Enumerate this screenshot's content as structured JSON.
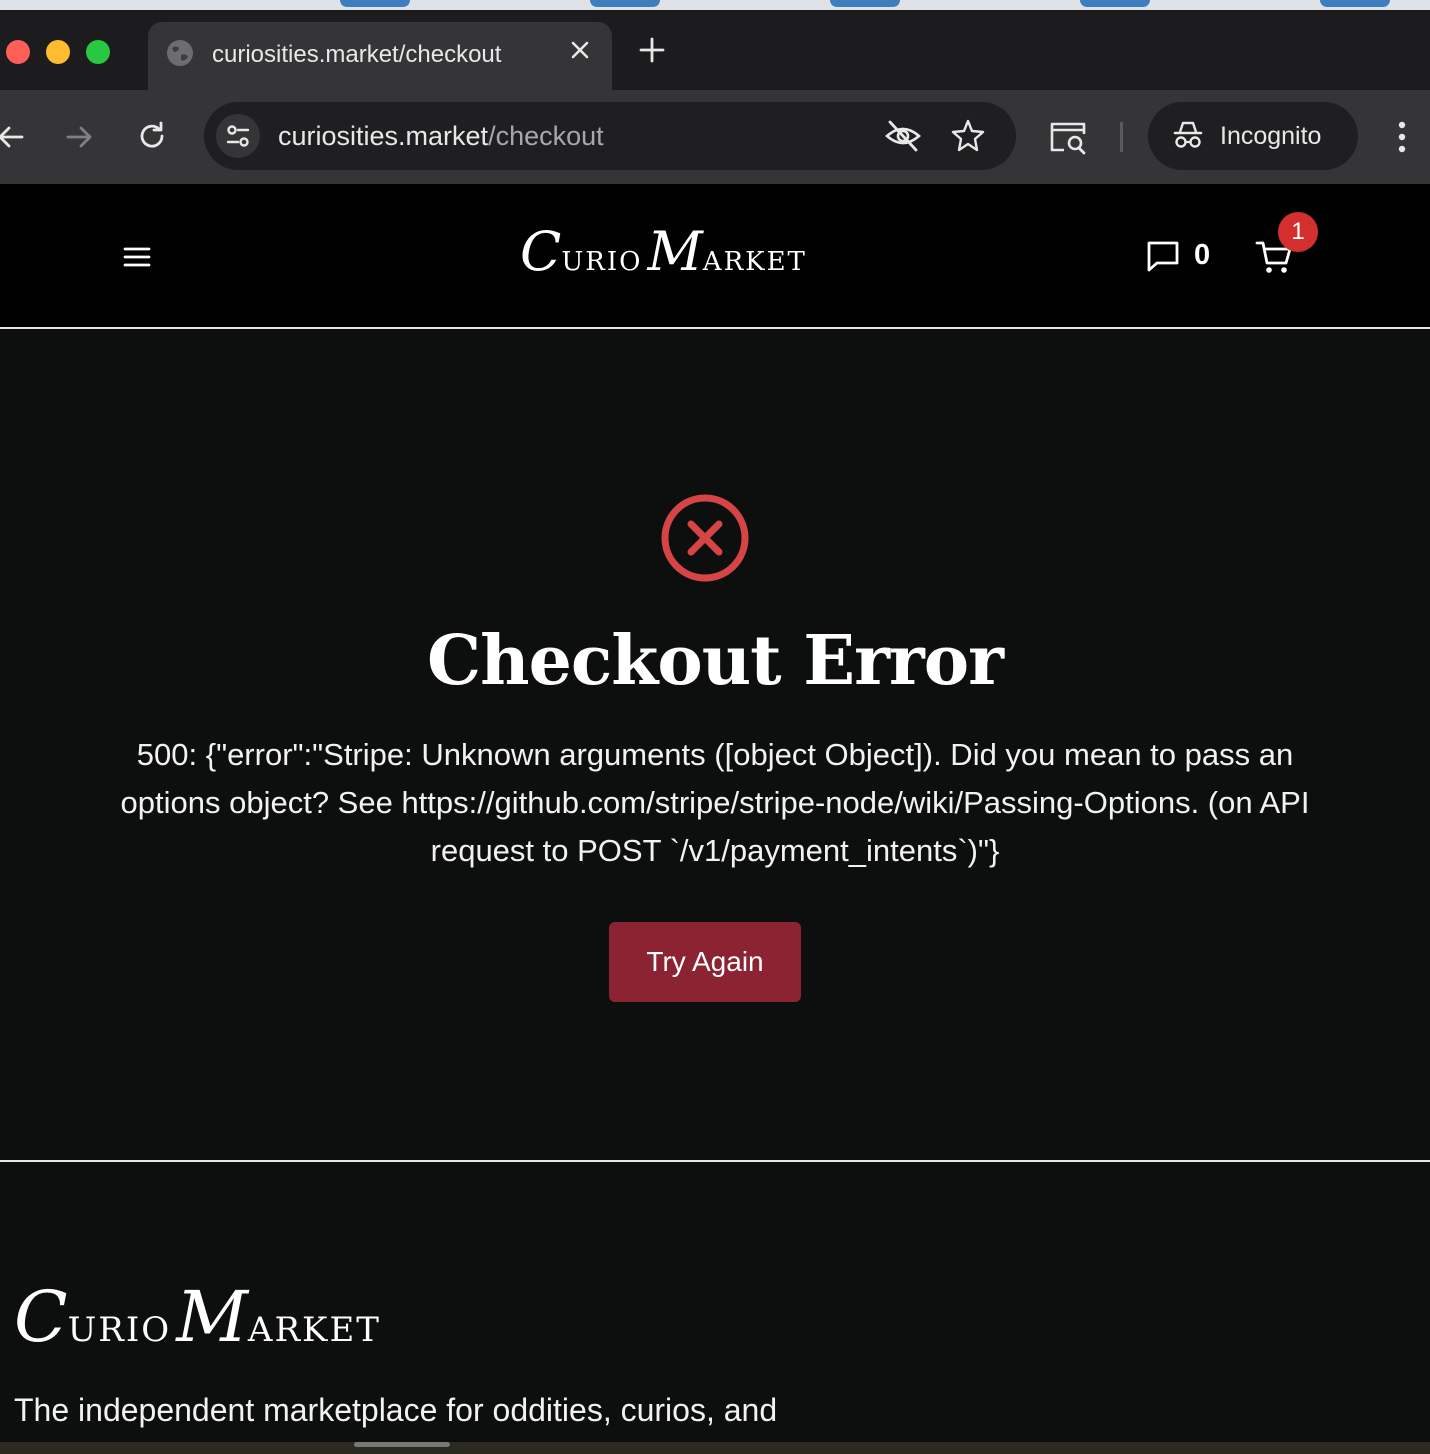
{
  "browser": {
    "tab_title": "curiosities.market/checkout",
    "url_host": "curiosities.market",
    "url_path": "/checkout",
    "incognito_label": "Incognito",
    "icons": [
      "globe-icon",
      "close-icon",
      "plus-icon",
      "back-arrow-icon",
      "forward-arrow-icon",
      "reload-icon",
      "site-settings-icon",
      "eye-off-icon",
      "star-icon",
      "lens-icon",
      "incognito-icon",
      "kebab-menu-icon"
    ]
  },
  "header": {
    "logo": {
      "cap1": "C",
      "rest1": "URIO",
      "cap2": "M",
      "rest2": "ARKET"
    },
    "message_count": "0",
    "cart_count": "1",
    "icons": [
      "hamburger-icon",
      "message-icon",
      "cart-icon"
    ]
  },
  "error": {
    "title": "Checkout Error",
    "message": "500: {\"error\":\"Stripe: Unknown arguments ([object Object]). Did you mean to pass an options object? See https://github.com/stripe/stripe-node/wiki/Passing-Options. (on API request to POST `/v1/payment_intents`)\"}",
    "retry_label": "Try Again",
    "icon": "x-circle-icon",
    "accent_color": "#d64545",
    "button_color": "#8b2332"
  },
  "footer": {
    "logo": {
      "cap1": "C",
      "rest1": "URIO",
      "cap2": "M",
      "rest2": "ARKET"
    },
    "tagline": "The independent marketplace for oddities, curios, and"
  }
}
